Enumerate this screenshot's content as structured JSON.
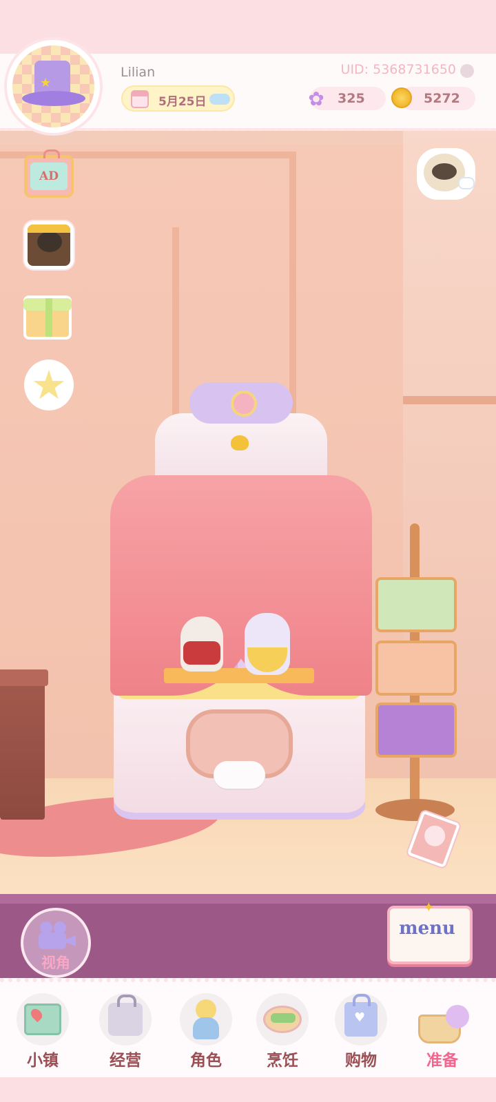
{
  "profile": {
    "username": "Lilian",
    "uid_text": "UID: 5368731650",
    "avatar_icon": "top-hat-avatar-icon"
  },
  "status": {
    "date": "5月25日",
    "weather_icon": "cloud-icon",
    "gems": "325",
    "coins": "5272"
  },
  "side_widgets": [
    {
      "name": "ad-tv-button",
      "label": "AD"
    },
    {
      "name": "treasure-chest-button",
      "icon": "chest-icon"
    },
    {
      "name": "gift-box-button",
      "icon": "gift-icon"
    },
    {
      "name": "star-character-button",
      "icon": "star-icon"
    }
  ],
  "chat": {
    "icon": "cat-chat-icon"
  },
  "recipe": {
    "icon": "recipe-book-icon"
  },
  "camera": {
    "label": "视角",
    "icon": "camera-icon"
  },
  "menu": {
    "label": "menu"
  },
  "nav": {
    "items": [
      {
        "label": "小镇",
        "icon": "map-icon"
      },
      {
        "label": "经营",
        "icon": "bag-icon"
      },
      {
        "label": "角色",
        "icon": "character-icon"
      },
      {
        "label": "烹饪",
        "icon": "food-icon"
      },
      {
        "label": "购物",
        "icon": "shopping-bag-icon"
      },
      {
        "label": "准备",
        "icon": "basket-icon"
      }
    ],
    "active_index": 5
  },
  "colors": {
    "accent_pink": "#f2678d",
    "nav_label": "#9a4f54",
    "band_purple": "#9c5987"
  }
}
